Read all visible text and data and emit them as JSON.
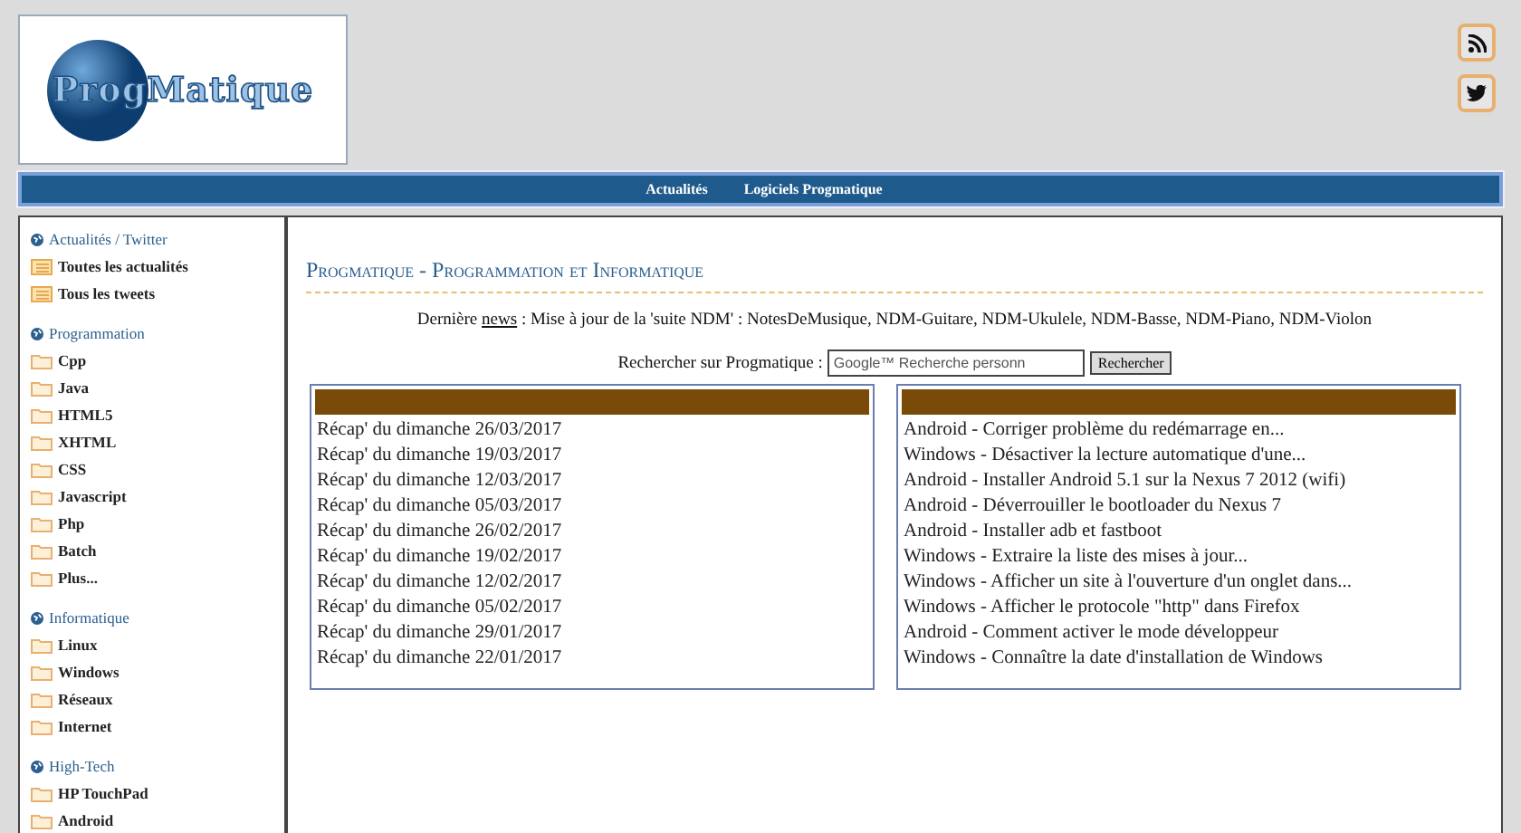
{
  "header": {
    "logo": "ProgMatique",
    "social": [
      {
        "kind": "rss"
      },
      {
        "kind": "twitter"
      }
    ]
  },
  "nav": {
    "links": [
      "Actualités",
      "Logiciels Progmatique"
    ]
  },
  "sidebar": {
    "sections": [
      {
        "title": "Actualités / Twitter",
        "items": [
          {
            "label": "Toutes les actualités",
            "kind": "list"
          },
          {
            "label": "Tous les tweets",
            "kind": "list"
          }
        ]
      },
      {
        "title": "Programmation",
        "items": [
          {
            "label": "Cpp",
            "kind": "folder"
          },
          {
            "label": "Java",
            "kind": "folder"
          },
          {
            "label": "HTML5",
            "kind": "folder"
          },
          {
            "label": "XHTML",
            "kind": "folder"
          },
          {
            "label": "CSS",
            "kind": "folder"
          },
          {
            "label": "Javascript",
            "kind": "folder"
          },
          {
            "label": "Php",
            "kind": "folder"
          },
          {
            "label": "Batch",
            "kind": "folder"
          },
          {
            "label": "Plus...",
            "kind": "folder"
          }
        ]
      },
      {
        "title": "Informatique",
        "items": [
          {
            "label": "Linux",
            "kind": "folder"
          },
          {
            "label": "Windows",
            "kind": "folder"
          },
          {
            "label": "Réseaux",
            "kind": "folder"
          },
          {
            "label": "Internet",
            "kind": "folder"
          }
        ]
      },
      {
        "title": "High-Tech",
        "items": [
          {
            "label": "HP TouchPad",
            "kind": "folder"
          },
          {
            "label": "Android",
            "kind": "folder"
          }
        ]
      }
    ]
  },
  "main": {
    "title": "Progmatique - Programmation et Informatique",
    "news": {
      "prefix": "Dernière",
      "link": "news",
      "text": ": Mise à jour de la 'suite NDM' : NotesDeMusique, NDM-Guitare, NDM-Ukulele, NDM-Basse, NDM-Piano, NDM-Violon"
    },
    "search": {
      "label": "Rechercher sur Progmatique :",
      "placeholder": "Google™ Recherche personn",
      "button": "Rechercher"
    },
    "boxes": [
      {
        "rows": [
          "Récap' du dimanche 26/03/2017",
          "Récap' du dimanche 19/03/2017",
          "Récap' du dimanche 12/03/2017",
          "Récap' du dimanche 05/03/2017",
          "Récap' du dimanche 26/02/2017",
          "Récap' du dimanche 19/02/2017",
          "Récap' du dimanche 12/02/2017",
          "Récap' du dimanche 05/02/2017",
          "Récap' du dimanche 29/01/2017",
          "Récap' du dimanche 22/01/2017"
        ]
      },
      {
        "rows": [
          "Android - Corriger problème du redémarrage en...",
          "Windows - Désactiver la lecture automatique d'une...",
          "Android - Installer Android 5.1 sur la Nexus 7 2012 (wifi)",
          "Android - Déverrouiller le bootloader du Nexus 7",
          "Android - Installer adb et fastboot",
          "Windows - Extraire la liste des mises à jour...",
          "Windows - Afficher un site à l'ouverture d'un onglet dans...",
          "Windows - Afficher le protocole \"http\" dans Firefox",
          "Android - Comment activer le mode développeur",
          "Windows - Connaître la date d'installation de Windows"
        ]
      }
    ]
  }
}
